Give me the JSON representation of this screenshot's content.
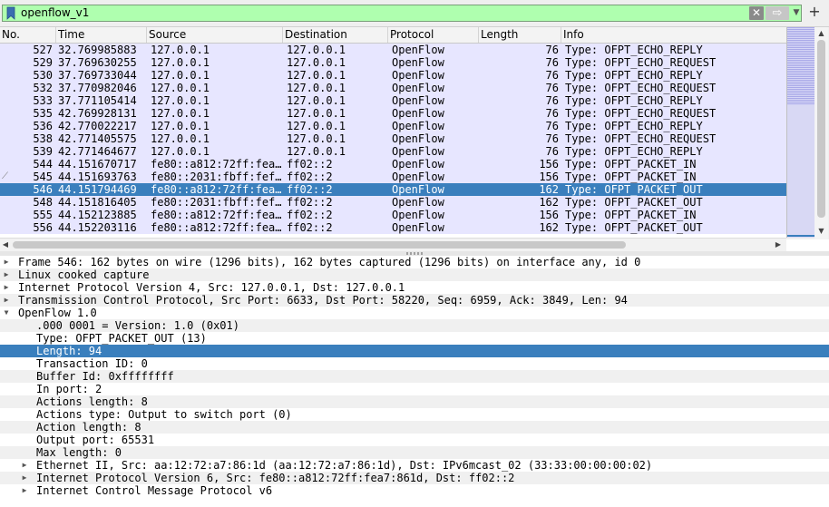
{
  "filter": {
    "value": "openflow_v1",
    "clear_icon": "clear-x-icon",
    "apply_icon": "arrow-right-icon",
    "history_icon": "chevron-down-icon",
    "add_icon": "plus-icon"
  },
  "colors": {
    "filter_valid": "#afffaf",
    "row_bg": "#e7e6ff",
    "selection": "#3a7fbd"
  },
  "columns": {
    "no": "No.",
    "time": "Time",
    "source": "Source",
    "destination": "Destination",
    "protocol": "Protocol",
    "length": "Length",
    "info": "Info"
  },
  "packets": [
    {
      "no": "527",
      "time": "32.769985883",
      "source": "127.0.0.1",
      "destination": "127.0.0.1",
      "protocol": "OpenFlow",
      "length": "76",
      "info": "Type: OFPT_ECHO_REPLY"
    },
    {
      "no": "529",
      "time": "37.769630255",
      "source": "127.0.0.1",
      "destination": "127.0.0.1",
      "protocol": "OpenFlow",
      "length": "76",
      "info": "Type: OFPT_ECHO_REQUEST"
    },
    {
      "no": "530",
      "time": "37.769733044",
      "source": "127.0.0.1",
      "destination": "127.0.0.1",
      "protocol": "OpenFlow",
      "length": "76",
      "info": "Type: OFPT_ECHO_REPLY"
    },
    {
      "no": "532",
      "time": "37.770982046",
      "source": "127.0.0.1",
      "destination": "127.0.0.1",
      "protocol": "OpenFlow",
      "length": "76",
      "info": "Type: OFPT_ECHO_REQUEST"
    },
    {
      "no": "533",
      "time": "37.771105414",
      "source": "127.0.0.1",
      "destination": "127.0.0.1",
      "protocol": "OpenFlow",
      "length": "76",
      "info": "Type: OFPT_ECHO_REPLY"
    },
    {
      "no": "535",
      "time": "42.769928131",
      "source": "127.0.0.1",
      "destination": "127.0.0.1",
      "protocol": "OpenFlow",
      "length": "76",
      "info": "Type: OFPT_ECHO_REQUEST"
    },
    {
      "no": "536",
      "time": "42.770022217",
      "source": "127.0.0.1",
      "destination": "127.0.0.1",
      "protocol": "OpenFlow",
      "length": "76",
      "info": "Type: OFPT_ECHO_REPLY"
    },
    {
      "no": "538",
      "time": "42.771405575",
      "source": "127.0.0.1",
      "destination": "127.0.0.1",
      "protocol": "OpenFlow",
      "length": "76",
      "info": "Type: OFPT_ECHO_REQUEST"
    },
    {
      "no": "539",
      "time": "42.771464677",
      "source": "127.0.0.1",
      "destination": "127.0.0.1",
      "protocol": "OpenFlow",
      "length": "76",
      "info": "Type: OFPT_ECHO_REPLY"
    },
    {
      "no": "544",
      "time": "44.151670717",
      "source": "fe80::a812:72ff:fea…",
      "destination": "ff02::2",
      "protocol": "OpenFlow",
      "length": "156",
      "info": "Type: OFPT_PACKET_IN"
    },
    {
      "no": "545",
      "time": "44.151693763",
      "source": "fe80::2031:fbff:fef…",
      "destination": "ff02::2",
      "protocol": "OpenFlow",
      "length": "156",
      "info": "Type: OFPT_PACKET_IN",
      "related": true
    },
    {
      "no": "546",
      "time": "44.151794469",
      "source": "fe80::a812:72ff:fea…",
      "destination": "ff02::2",
      "protocol": "OpenFlow",
      "length": "162",
      "info": "Type: OFPT_PACKET_OUT",
      "selected": true
    },
    {
      "no": "548",
      "time": "44.151816405",
      "source": "fe80::2031:fbff:fef…",
      "destination": "ff02::2",
      "protocol": "OpenFlow",
      "length": "162",
      "info": "Type: OFPT_PACKET_OUT"
    },
    {
      "no": "555",
      "time": "44.152123885",
      "source": "fe80::a812:72ff:fea…",
      "destination": "ff02::2",
      "protocol": "OpenFlow",
      "length": "156",
      "info": "Type: OFPT_PACKET_IN"
    },
    {
      "no": "556",
      "time": "44.152203116",
      "source": "fe80::a812:72ff:fea…",
      "destination": "ff02::2",
      "protocol": "OpenFlow",
      "length": "162",
      "info": "Type: OFPT_PACKET_OUT"
    }
  ],
  "details": [
    {
      "text": "Frame 546: 162 bytes on wire (1296 bits), 162 bytes captured (1296 bits) on interface any, id 0",
      "level": 0,
      "expander": "collapsed"
    },
    {
      "text": "Linux cooked capture",
      "level": 0,
      "expander": "collapsed"
    },
    {
      "text": "Internet Protocol Version 4, Src: 127.0.0.1, Dst: 127.0.0.1",
      "level": 0,
      "expander": "collapsed"
    },
    {
      "text": "Transmission Control Protocol, Src Port: 6633, Dst Port: 58220, Seq: 6959, Ack: 3849, Len: 94",
      "level": 0,
      "expander": "collapsed"
    },
    {
      "text": "OpenFlow 1.0",
      "level": 0,
      "expander": "expanded"
    },
    {
      "text": ".000 0001 = Version: 1.0 (0x01)",
      "level": 1,
      "expander": "none"
    },
    {
      "text": "Type: OFPT_PACKET_OUT (13)",
      "level": 1,
      "expander": "none"
    },
    {
      "text": "Length: 94",
      "level": 1,
      "expander": "none",
      "selected": true
    },
    {
      "text": "Transaction ID: 0",
      "level": 1,
      "expander": "none"
    },
    {
      "text": "Buffer Id: 0xffffffff",
      "level": 1,
      "expander": "none"
    },
    {
      "text": "In port: 2",
      "level": 1,
      "expander": "none"
    },
    {
      "text": "Actions length: 8",
      "level": 1,
      "expander": "none"
    },
    {
      "text": "Actions type: Output to switch port (0)",
      "level": 1,
      "expander": "none"
    },
    {
      "text": "Action length: 8",
      "level": 1,
      "expander": "none"
    },
    {
      "text": "Output port: 65531",
      "level": 1,
      "expander": "none"
    },
    {
      "text": "Max length: 0",
      "level": 1,
      "expander": "none"
    },
    {
      "text": "Ethernet II, Src: aa:12:72:a7:86:1d (aa:12:72:a7:86:1d), Dst: IPv6mcast_02 (33:33:00:00:00:02)",
      "level": 1,
      "expander": "collapsed"
    },
    {
      "text": "Internet Protocol Version 6, Src: fe80::a812:72ff:fea7:861d, Dst: ff02::2",
      "level": 1,
      "expander": "collapsed"
    },
    {
      "text": "Internet Control Message Protocol v6",
      "level": 1,
      "expander": "collapsed"
    }
  ]
}
